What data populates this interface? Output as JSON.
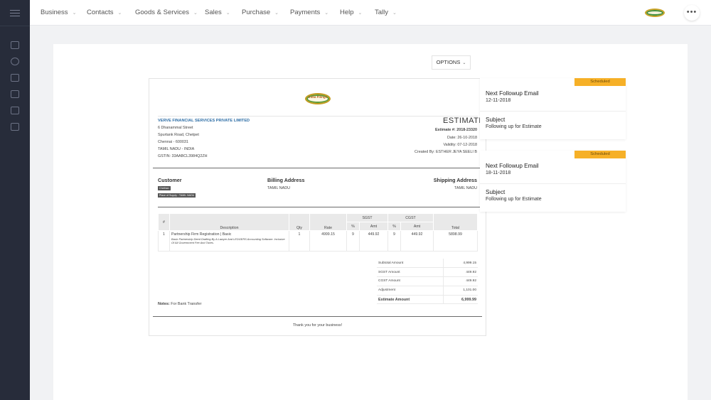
{
  "nav": {
    "items": [
      "Business",
      "Contacts",
      "Goods & Services",
      "Sales",
      "Purchase",
      "Payments",
      "Help",
      "Tally"
    ],
    "more": "•••"
  },
  "options_label": "OPTIONS",
  "doc": {
    "logo_text": "India Filings",
    "company": {
      "name": "VERVE FINANCIAL SERVICES PRIVATE LIMITED",
      "address": [
        "6 Dhanammal Street",
        "Spurtank Road, Chetpet",
        "Chennai - 600031",
        "TAMIL NADU - INDIA",
        "GSTIN: 33AABCL3984Q2ZH"
      ]
    },
    "title": "ESTIMATE",
    "meta": {
      "number": "Estimate #: 2018-23320",
      "date": "Date: 26-10-2018",
      "validity": "Validity: 07-12-2018",
      "created_by": "Created By: ESTHER JEYA SEELI B"
    },
    "customer": {
      "heading": "Customer",
      "name": "Chethan",
      "place_of_supply": "Place of Supply : TAMIL NADU"
    },
    "billing": {
      "heading": "Billing Address",
      "state": "TAMIL NADU"
    },
    "shipping": {
      "heading": "Shipping Address",
      "state": "TAMIL NADU"
    },
    "table": {
      "headers": {
        "num": "#",
        "description": "Description",
        "qty": "Qty",
        "rate": "Rate",
        "sgst": "SGST",
        "cgst": "CGST",
        "pct": "%",
        "amt": "Amt",
        "total": "Total"
      },
      "rows": [
        {
          "num": "1",
          "name": "Partnership Firm Registration | Basic",
          "detail": "Basic Partnership Deed Drafting By A Lawyer And LEDGERS Accounting Software. Inclusive Of All Government Fee And Taxes.",
          "qty": "1",
          "rate": "4999.15",
          "sgst_pct": "9",
          "sgst_amt": "449.92",
          "cgst_pct": "9",
          "cgst_amt": "449.92",
          "total": "5898.99"
        }
      ]
    },
    "summary": [
      {
        "label": "Subtotal Amount",
        "value": "4,999.15"
      },
      {
        "label": "SGST Amount",
        "value": "449.92"
      },
      {
        "label": "CGST Amount",
        "value": "449.92"
      },
      {
        "label": "Adjustment",
        "value": "1,101.00"
      },
      {
        "label": "Estimate Amount",
        "value": "6,999.99"
      }
    ],
    "notes_label": "Notes:",
    "notes_value": "For Bank Transfer",
    "thanks": "Thank you for your business!"
  },
  "followups": [
    {
      "badge": "Scheduled",
      "title": "Next Followup Email",
      "date": "12-11-2018",
      "subject_label": "Subject",
      "subject": "Following up for Estimate"
    },
    {
      "badge": "Scheduled",
      "title": "Next Followup Email",
      "date": "18-11-2018",
      "subject_label": "Subject",
      "subject": "Following up for Estimate"
    }
  ]
}
